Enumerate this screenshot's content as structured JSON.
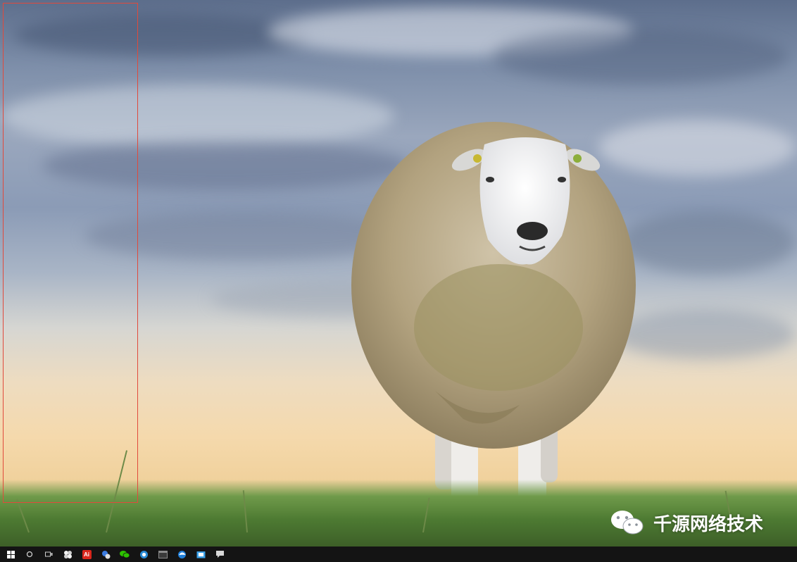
{
  "watermark": {
    "text": "千源网络技术",
    "icon": "wechat-icon"
  },
  "taskbar": {
    "items": [
      {
        "name": "start-button",
        "icon": "windows-logo-icon",
        "color": "#ffffff"
      },
      {
        "name": "search-button",
        "icon": "search-circle-icon",
        "color": "#cfcfcf"
      },
      {
        "name": "task-view-button",
        "icon": "task-view-icon",
        "color": "#cfcfcf"
      },
      {
        "name": "taskbar-app-pinwheel",
        "icon": "pinwheel-icon",
        "color": "#f2f2f2"
      },
      {
        "name": "taskbar-app-adobe",
        "icon": "adobe-icon",
        "color": "#d9261c",
        "label": "Ai"
      },
      {
        "name": "taskbar-app-people",
        "icon": "people-icon",
        "color": "#3b7be0"
      },
      {
        "name": "taskbar-app-wechat",
        "icon": "wechat-icon",
        "color": "#2dc100"
      },
      {
        "name": "taskbar-app-browser",
        "icon": "browser-icon",
        "color": "#2a8ad4"
      },
      {
        "name": "taskbar-app-window",
        "icon": "window-icon",
        "color": "#8a8a8a"
      },
      {
        "name": "taskbar-app-edge",
        "icon": "edge-icon",
        "color": "#1f7ed8"
      },
      {
        "name": "taskbar-app-explorer",
        "icon": "folder-icon",
        "color": "#3aa0e8"
      },
      {
        "name": "taskbar-app-chat",
        "icon": "chat-icon",
        "color": "#d8d8d8"
      }
    ]
  },
  "colors": {
    "selection_border": "#e04a3c",
    "taskbar_bg": "#141414"
  }
}
